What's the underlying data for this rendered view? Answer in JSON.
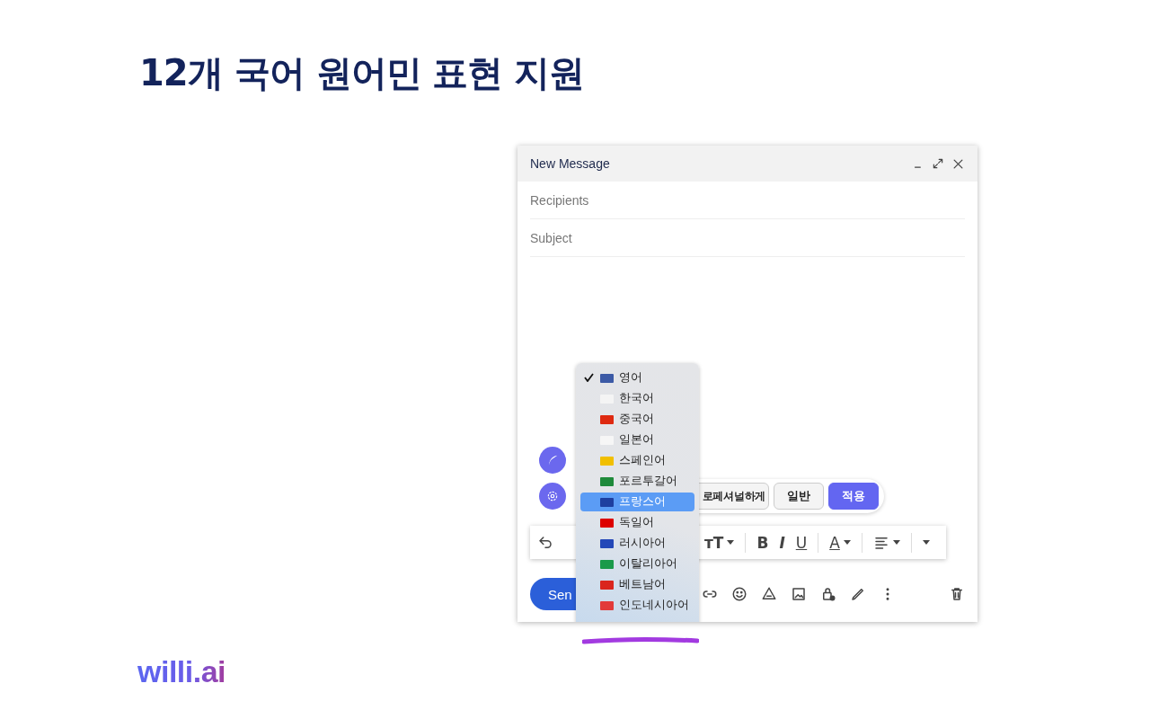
{
  "headline": "12개 국어 원어민 표현 지원",
  "compose": {
    "title": "New Message",
    "recipients": {
      "placeholder": "Recipients"
    },
    "subject": {
      "placeholder": "Subject"
    },
    "tone_buttons": [
      {
        "label": "로페셔널하게",
        "kind": "option"
      },
      {
        "label": "일반",
        "kind": "option"
      },
      {
        "label": "적용",
        "kind": "primary"
      }
    ],
    "format_buttons": [
      {
        "label": "тT",
        "caret": true
      },
      {
        "label": "B",
        "caret": false
      },
      {
        "label": "I",
        "caret": false
      },
      {
        "label": "U",
        "caret": false
      },
      {
        "label": "A",
        "caret": true
      }
    ],
    "send_button": "Sen"
  },
  "language_menu": {
    "items": [
      {
        "label": "영어",
        "checked": true,
        "selected": false,
        "color": "#3c5aa6"
      },
      {
        "label": "한국어",
        "checked": false,
        "selected": false,
        "color": "#f4f4f4"
      },
      {
        "label": "중국어",
        "checked": false,
        "selected": false,
        "color": "#de2910"
      },
      {
        "label": "일본어",
        "checked": false,
        "selected": false,
        "color": "#f6f6f6"
      },
      {
        "label": "스페인어",
        "checked": false,
        "selected": false,
        "color": "#f1bf00"
      },
      {
        "label": "포르투갈어",
        "checked": false,
        "selected": false,
        "color": "#1f8a3b"
      },
      {
        "label": "프랑스어",
        "checked": false,
        "selected": true,
        "color": "#1e3fa0"
      },
      {
        "label": "독일어",
        "checked": false,
        "selected": false,
        "color": "#dd0000"
      },
      {
        "label": "러시아어",
        "checked": false,
        "selected": false,
        "color": "#2448b8"
      },
      {
        "label": "이탈리아어",
        "checked": false,
        "selected": false,
        "color": "#1a9a4a"
      },
      {
        "label": "베트남어",
        "checked": false,
        "selected": false,
        "color": "#da251d"
      },
      {
        "label": "인도네시아어",
        "checked": false,
        "selected": false,
        "color": "#e23a3a"
      }
    ]
  },
  "logo": "willi.ai"
}
